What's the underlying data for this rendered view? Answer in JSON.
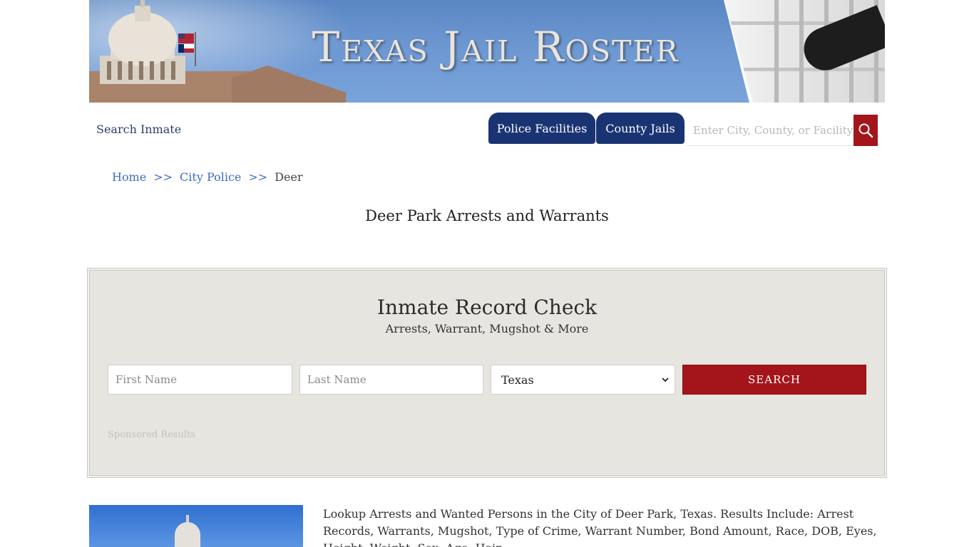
{
  "banner": {
    "title": "Texas Jail Roster"
  },
  "nav": {
    "search_inmate": "Search Inmate",
    "tabs": [
      {
        "label": "Police Facilities"
      },
      {
        "label": "County Jails"
      }
    ],
    "site_search_placeholder": "Enter City, County, or Facility"
  },
  "breadcrumb": {
    "items": [
      "Home",
      "City Police"
    ],
    "separator": ">>",
    "current": "Deer"
  },
  "page_title": "Deer Park Arrests and Warrants",
  "record_check": {
    "heading": "Inmate Record Check",
    "subheading": "Arrests, Warrant, Mugshot & More",
    "first_name_placeholder": "First Name",
    "last_name_placeholder": "Last Name",
    "state_selected": "Texas",
    "search_label": "SEARCH",
    "sponsored": "Sponsored Results"
  },
  "description": "Lookup Arrests and Wanted Persons in the City of Deer Park, Texas. Results Include: Arrest Records, Warrants, Mugshot, Type of Crime, Warrant Number, Bond Amount, Race, DOB, Eyes, Height, Weight, Sex, Age, Hair",
  "colors": {
    "nav_blue": "#1a3473",
    "accent_red": "#a3151b",
    "link_blue": "#3b6fc4",
    "panel_bg": "#e7e5e0"
  },
  "icons": {
    "site_search": "search-icon",
    "state_dropdown": "chevron-down-icon"
  }
}
